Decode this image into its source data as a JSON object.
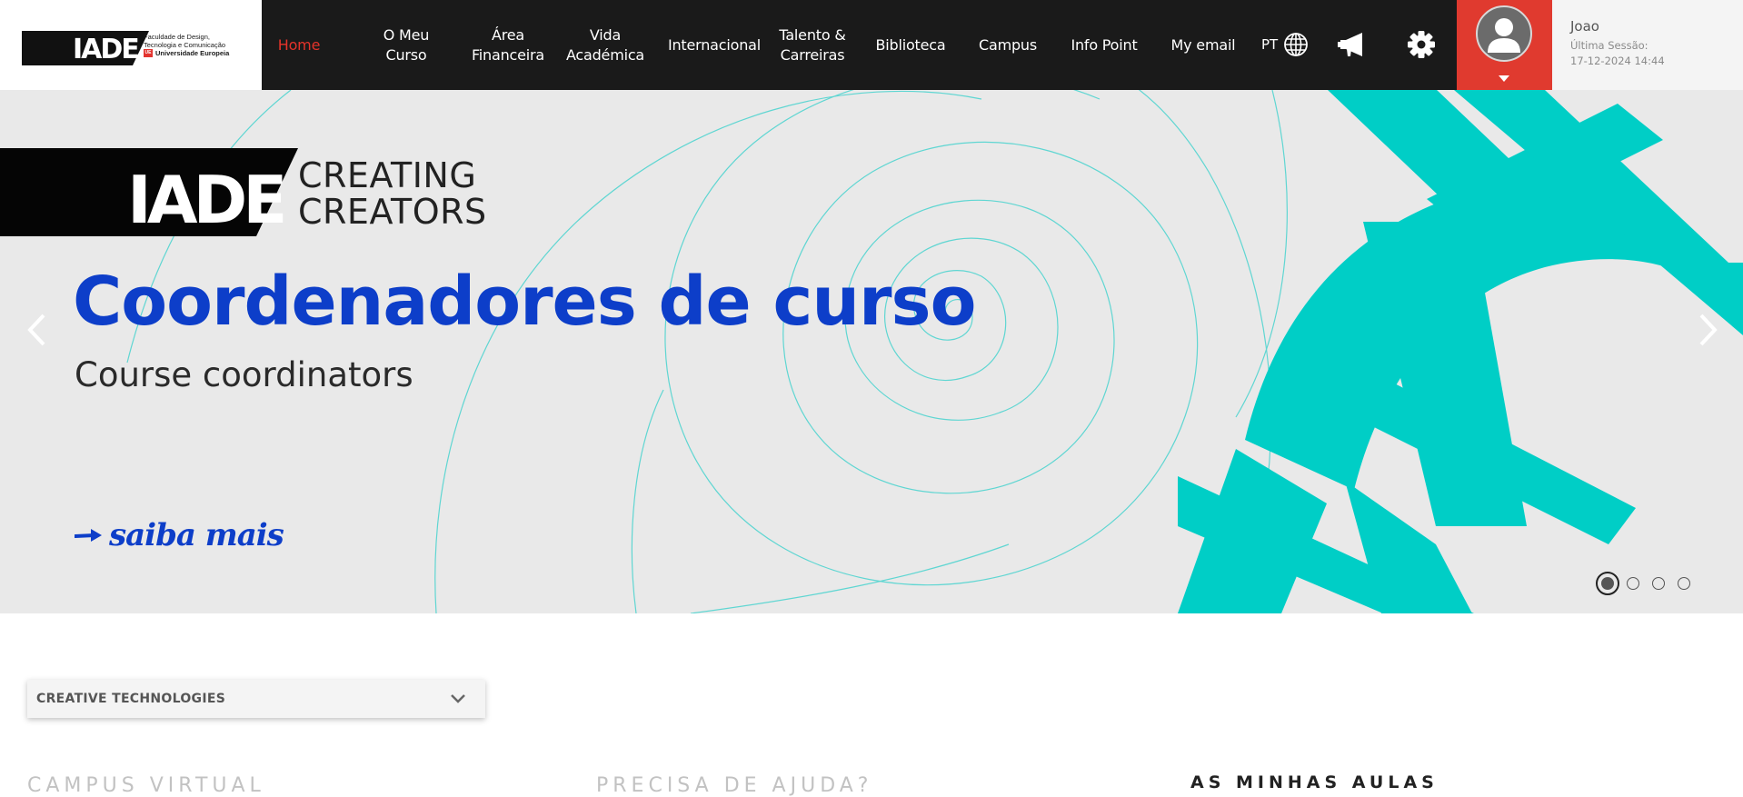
{
  "logo": {
    "mark": "IADE",
    "text_line1": "Faculdade de Design,",
    "text_line2": "Tecnologia e Comunicação",
    "text_line3": "Universidade Europeia",
    "ue_badge": "UE"
  },
  "nav": {
    "items": [
      {
        "label": "Home",
        "active": true
      },
      {
        "label": "O Meu\nCurso"
      },
      {
        "label": "Área\nFinanceira"
      },
      {
        "label": "Vida\nAcadémica"
      },
      {
        "label": "Internacional"
      },
      {
        "label": "Talento &\nCarreiras"
      },
      {
        "label": "Biblioteca"
      },
      {
        "label": "Campus"
      },
      {
        "label": "Info Point"
      },
      {
        "label": "My email"
      }
    ],
    "language": "PT",
    "icons": [
      "globe-icon",
      "megaphone-icon",
      "gear-icon"
    ]
  },
  "user": {
    "name": "Joao",
    "last_session_label": "Última Sessão:",
    "last_session_value": "17-12-2024 14:44"
  },
  "hero": {
    "banner_mark": "IADE",
    "tagline_line1": "CREATING",
    "tagline_line2": "CREATORS",
    "title": "Coordenadores de curso",
    "subtitle": "Course coordinators",
    "cta": "saiba mais",
    "slides_total": 4,
    "slide_active": 1
  },
  "course_selector": {
    "selected": "CREATIVE TECHNOLOGIES"
  },
  "sections": {
    "campus_virtual": "CAMPUS VIRTUAL",
    "precisa_ajuda": "PRECISA DE AJUDA?",
    "minhas_aulas": "AS MINHAS AULAS"
  },
  "colors": {
    "topbar": "#1a1a1a",
    "accent_red": "#e03a2f",
    "hero_blue": "#0d3ec9",
    "hero_teal": "#00cec6",
    "hero_bg": "#e9e9e9"
  }
}
